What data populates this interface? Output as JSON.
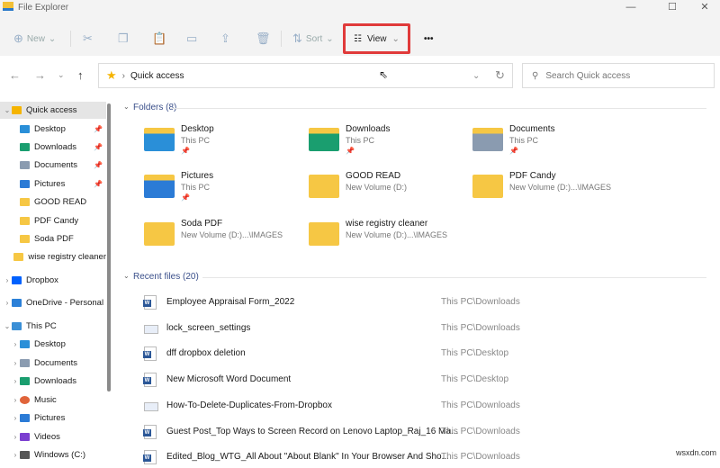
{
  "window": {
    "title": "File Explorer",
    "minimize": "—",
    "maximize": "☐",
    "close": "✕"
  },
  "toolbar": {
    "new": "New",
    "sort": "Sort",
    "view": "View",
    "more": "•••"
  },
  "nav": {
    "back": "←",
    "forward": "→",
    "recent": "⌄",
    "up": "↑",
    "refresh": "↻",
    "address_chevron": "⌄"
  },
  "address": {
    "path": "Quick access"
  },
  "search": {
    "placeholder": "Search Quick access"
  },
  "sidebar": {
    "items": [
      {
        "label": "Quick access",
        "icon": "star"
      },
      {
        "label": "Desktop",
        "icon": "desktop",
        "pinned": true
      },
      {
        "label": "Downloads",
        "icon": "download",
        "pinned": true
      },
      {
        "label": "Documents",
        "icon": "documents",
        "pinned": true
      },
      {
        "label": "Pictures",
        "icon": "pictures",
        "pinned": true
      },
      {
        "label": "GOOD READ",
        "icon": "folder"
      },
      {
        "label": "PDF Candy",
        "icon": "folder"
      },
      {
        "label": "Soda PDF",
        "icon": "folder"
      },
      {
        "label": "wise registry cleaner",
        "icon": "folder"
      },
      {
        "label": "Dropbox",
        "icon": "dropbox"
      },
      {
        "label": "OneDrive - Personal",
        "icon": "onedrive"
      },
      {
        "label": "This PC",
        "icon": "pc"
      },
      {
        "label": "Desktop",
        "icon": "desktop"
      },
      {
        "label": "Documents",
        "icon": "documents"
      },
      {
        "label": "Downloads",
        "icon": "download"
      },
      {
        "label": "Music",
        "icon": "music"
      },
      {
        "label": "Pictures",
        "icon": "pictures"
      },
      {
        "label": "Videos",
        "icon": "videos"
      },
      {
        "label": "Windows (C:)",
        "icon": "drive"
      }
    ]
  },
  "folders": {
    "header": "Folders (8)",
    "items": [
      {
        "name": "Desktop",
        "location": "This PC",
        "pinned": true,
        "icon": "desktop"
      },
      {
        "name": "Downloads",
        "location": "This PC",
        "pinned": true,
        "icon": "download"
      },
      {
        "name": "Documents",
        "location": "This PC",
        "pinned": true,
        "icon": "documents"
      },
      {
        "name": "Pictures",
        "location": "This PC",
        "pinned": true,
        "icon": "pictures"
      },
      {
        "name": "GOOD READ",
        "location": "New Volume (D:)",
        "icon": "folder"
      },
      {
        "name": "PDF Candy",
        "location": "New Volume (D:)...\\IMAGES",
        "icon": "folder"
      },
      {
        "name": "Soda PDF",
        "location": "New Volume (D:)...\\IMAGES",
        "icon": "folder"
      },
      {
        "name": "wise registry cleaner",
        "location": "New Volume (D:)...\\IMAGES",
        "icon": "folder"
      }
    ]
  },
  "recent": {
    "header": "Recent files (20)",
    "items": [
      {
        "name": "Employee Appraisal Form_2022",
        "location": "This PC\\Downloads",
        "icon": "word"
      },
      {
        "name": "lock_screen_settings",
        "location": "This PC\\Downloads",
        "icon": "image"
      },
      {
        "name": "dff dropbox deletion",
        "location": "This PC\\Desktop",
        "icon": "word"
      },
      {
        "name": "New Microsoft Word Document",
        "location": "This PC\\Desktop",
        "icon": "word"
      },
      {
        "name": "How-To-Delete-Duplicates-From-Dropbox",
        "location": "This PC\\Downloads",
        "icon": "image"
      },
      {
        "name": "Guest Post_Top Ways to Screen Record on Lenovo Laptop_Raj_16 Ma...",
        "location": "This PC\\Downloads",
        "icon": "word"
      },
      {
        "name": "Edited_Blog_WTG_All About \"About Blank\" In Your Browser And Sho...",
        "location": "This PC\\Downloads",
        "icon": "word"
      }
    ]
  },
  "watermark": "wsxdn.com"
}
